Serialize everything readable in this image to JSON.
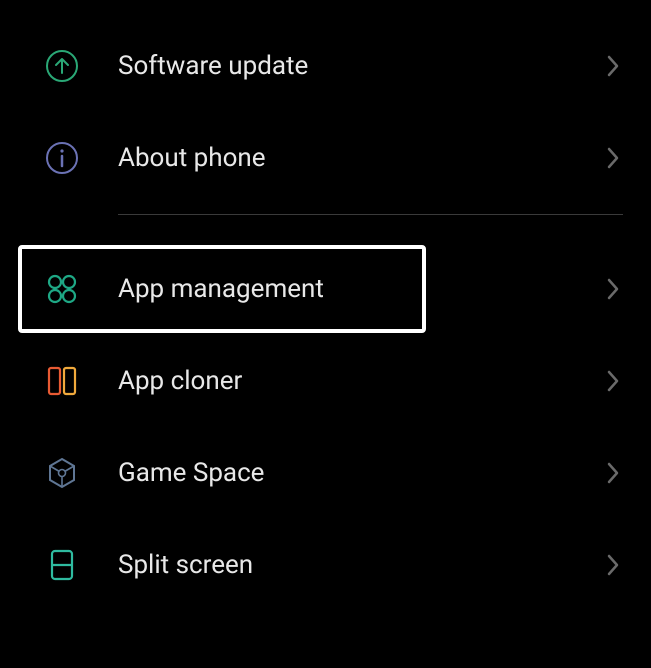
{
  "items": {
    "software_update": {
      "label": "Software update"
    },
    "about_phone": {
      "label": "About phone"
    },
    "app_management": {
      "label": "App management"
    },
    "app_cloner": {
      "label": "App cloner"
    },
    "game_space": {
      "label": "Game Space"
    },
    "split_screen": {
      "label": "Split screen"
    }
  },
  "colors": {
    "green": "#2aa876",
    "indigo": "#6b72b5",
    "teal": "#1ea885",
    "orange_left": "#e85a33",
    "orange_right": "#f0a93c",
    "steel": "#5f7694",
    "mint": "#2fbba0",
    "chevron": "#6a6a6a"
  }
}
